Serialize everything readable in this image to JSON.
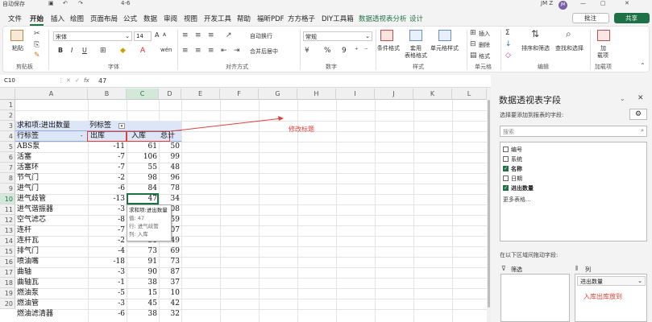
{
  "title": {
    "autosave": "自动保存",
    "doc": "4-6",
    "user": "JM Z",
    "avatar": "JM"
  },
  "menu": {
    "tabs": [
      "文件",
      "开始",
      "插入",
      "绘图",
      "页面布局",
      "公式",
      "数据",
      "审阅",
      "视图",
      "开发工具",
      "帮助",
      "福昕PDF",
      "方方格子",
      "DIY工具箱",
      "数据透视表分析",
      "设计"
    ],
    "active": "开始",
    "pivot_tab": "数据透视表分析",
    "comment": "批注",
    "share": "共享"
  },
  "ribbon": {
    "clipboard": {
      "paste": "粘贴",
      "label": "剪贴板"
    },
    "font": {
      "name": "宋体",
      "size": "14",
      "label": "字体",
      "bold": "B",
      "italic": "I",
      "underline": "U",
      "grow": "A",
      "shrink": "A",
      "wen": "wén"
    },
    "align": {
      "wrap": "自动换行",
      "merge": "合并后居中",
      "label": "对齐方式"
    },
    "number": {
      "format": "常规",
      "label": "数字",
      "percent": "%",
      "comma": "9"
    },
    "styles": {
      "cond": [
        "条件格式"
      ],
      "table": [
        "套用",
        "表格格式"
      ],
      "cell": [
        "单元格样式"
      ],
      "label": "样式"
    },
    "cells": {
      "insert": "插入",
      "delete": "删除",
      "format": "格式",
      "label": "单元格"
    },
    "editing": {
      "sort": [
        "排序和筛选"
      ],
      "find": [
        "查找和选择"
      ],
      "label": "编辑",
      "sigma": "Σ"
    },
    "addins": {
      "btn": [
        "加",
        "载项"
      ],
      "label": "加载项"
    }
  },
  "fx": {
    "namebox": "C10",
    "value": "47",
    "fx": "fx"
  },
  "columns": [
    "A",
    "B",
    "C",
    "D",
    "E",
    "F",
    "G",
    "H",
    "I",
    "J",
    "K",
    "L"
  ],
  "rows": [
    "1",
    "2",
    "3",
    "4",
    "5",
    "6",
    "7",
    "8",
    "9",
    "10",
    "11",
    "12",
    "13",
    "14",
    "15",
    "16",
    "17",
    "18",
    "19",
    "20"
  ],
  "pivot": {
    "header_a3": "求和项:进出数量",
    "col_label": "列标签",
    "row_label": "行标签",
    "out": "出库",
    "in": "入库",
    "total": "总计",
    "items": [
      {
        "name": "ABS泵",
        "out": "-11",
        "in": "61",
        "total": "50"
      },
      {
        "name": "活塞",
        "out": "-7",
        "in": "106",
        "total": "99"
      },
      {
        "name": "活塞环",
        "out": "-7",
        "in": "55",
        "total": "48"
      },
      {
        "name": "节气门",
        "out": "-2",
        "in": "98",
        "total": "96"
      },
      {
        "name": "进气门",
        "out": "-6",
        "in": "84",
        "total": "78"
      },
      {
        "name": "进气歧管",
        "out": "-13",
        "in": "47",
        "total": "34"
      },
      {
        "name": "进气谐振器",
        "out": "-3",
        "in": "",
        "total": "08"
      },
      {
        "name": "空气滤芯",
        "out": "-8",
        "in": "",
        "total": "59"
      },
      {
        "name": "连杆",
        "out": "-7",
        "in": "",
        "total": "07"
      },
      {
        "name": "连杆瓦",
        "out": "-2",
        "in": "51",
        "total": "49"
      },
      {
        "name": "排气门",
        "out": "-4",
        "in": "73",
        "total": "69"
      },
      {
        "name": "喷油嘴",
        "out": "-18",
        "in": "91",
        "total": "73"
      },
      {
        "name": "曲轴",
        "out": "-3",
        "in": "90",
        "total": "87"
      },
      {
        "name": "曲轴瓦",
        "out": "-1",
        "in": "38",
        "total": "37"
      },
      {
        "name": "燃油泵",
        "out": "-5",
        "in": "15",
        "total": "10"
      },
      {
        "name": "燃油管",
        "out": "-3",
        "in": "45",
        "total": "42"
      },
      {
        "name": "燃油滤清器",
        "out": "-6",
        "in": "38",
        "total": "32"
      }
    ],
    "tooltip": [
      "求和项:进出数量",
      "值: 47",
      "行: 进气歧管",
      "列: 入库"
    ]
  },
  "annotation": {
    "title_note": "修改标题",
    "dest_note": "入库出库放到"
  },
  "fieldpane": {
    "title": "数据透视表字段",
    "subtitle": "选择要添加到报表的字段:",
    "search": "搜索",
    "fields": [
      {
        "name": "编号",
        "checked": false
      },
      {
        "name": "系统",
        "checked": false
      },
      {
        "name": "名称",
        "checked": true
      },
      {
        "name": "日期",
        "checked": false
      },
      {
        "name": "进出数量",
        "checked": true
      }
    ],
    "more": "更多表格...",
    "drag_hint": "在以下区域间拖动字段:",
    "filter": "筛选",
    "column": "列",
    "col_item": "进出数量"
  },
  "colors": {
    "excel_green": "#1e7145",
    "pivot_header": "#dde6f7",
    "red": "#e0403a"
  }
}
